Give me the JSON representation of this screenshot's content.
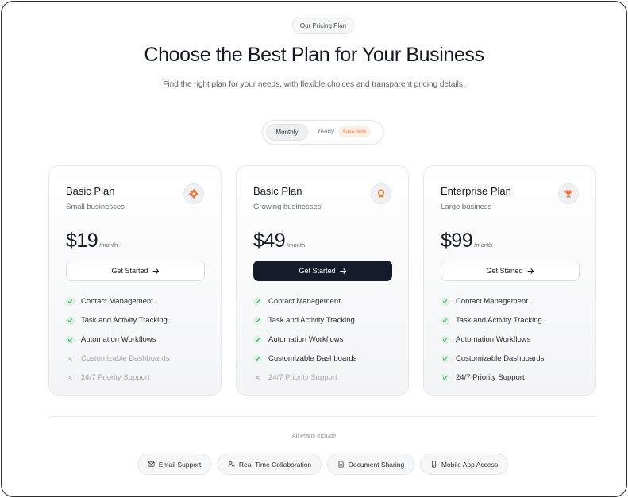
{
  "header": {
    "tag": "Our Pricing Plan",
    "title": "Choose the Best Plan for Your Business",
    "subtitle": "Find the right plan for your needs, with flexible choices and transparent pricing details."
  },
  "billing_toggle": {
    "monthly_label": "Monthly",
    "yearly_label": "Yearly",
    "save_badge": "Save 30%",
    "selected": "Monthly"
  },
  "plans": [
    {
      "name": "Basic Plan",
      "audience": "Small businesses",
      "price": "$19",
      "period": "/month",
      "cta_label": "Get Started",
      "icon": "gear-icon",
      "features": [
        {
          "label": "Contact Management",
          "included": true
        },
        {
          "label": "Task and Activity Tracking",
          "included": true
        },
        {
          "label": "Automation Workflows",
          "included": true
        },
        {
          "label": "Customizable Dashboards",
          "included": false
        },
        {
          "label": "24/7 Priority Support",
          "included": false
        }
      ]
    },
    {
      "name": "Basic Plan",
      "audience": "Growing businesses",
      "price": "$49",
      "period": "/month",
      "cta_label": "Get Started",
      "icon": "award-icon",
      "features": [
        {
          "label": "Contact Management",
          "included": true
        },
        {
          "label": "Task and Activity Tracking",
          "included": true
        },
        {
          "label": "Automation Workflows",
          "included": true
        },
        {
          "label": "Customizable Dashboards",
          "included": true
        },
        {
          "label": "24/7 Priority Support",
          "included": false
        }
      ]
    },
    {
      "name": "Enterprise Plan",
      "audience": "Large business",
      "price": "$99",
      "period": "/month",
      "cta_label": "Get Started",
      "icon": "trophy-icon",
      "features": [
        {
          "label": "Contact Management",
          "included": true
        },
        {
          "label": "Task and Activity Tracking",
          "included": true
        },
        {
          "label": "Automation Workflows",
          "included": true
        },
        {
          "label": "Customizable Dashboards",
          "included": true
        },
        {
          "label": "24/7 Priority Support",
          "included": true
        }
      ]
    }
  ],
  "includes": {
    "title": "All Plans Include",
    "items": [
      {
        "label": "Email Support",
        "icon": "mail-icon"
      },
      {
        "label": "Real-Time Collaboration",
        "icon": "users-icon"
      },
      {
        "label": "Document Sharing",
        "icon": "document-icon"
      },
      {
        "label": "Mobile App Access",
        "icon": "mobile-icon"
      }
    ]
  },
  "colors": {
    "accent": "#ec7a3c",
    "dark_button": "#161b2b",
    "check_green": "#2fb25a",
    "check_bg": "#dff5e6"
  }
}
